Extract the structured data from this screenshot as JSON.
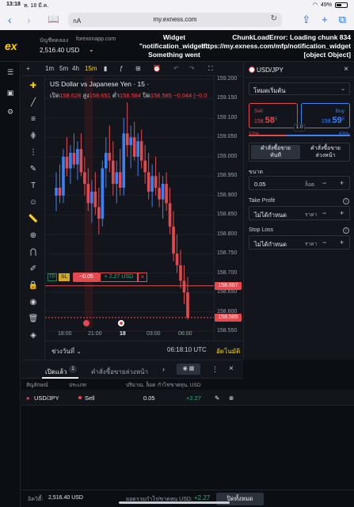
{
  "status_bar": {
    "time": "13:18",
    "date": "พ. 18 มี.ค.",
    "wifi": "wifi-icon",
    "battery_percent": "49%"
  },
  "browser": {
    "tab_label": "กA",
    "url": "my.exness.com",
    "back": "‹",
    "forward": "›"
  },
  "account": {
    "type": "บัญชีทดลอง",
    "server": "forexonapp.com",
    "balance": "2,516.40 USD"
  },
  "errors": {
    "widget": "Widget\n\"notification_widget\":\nSomething went\nwrong",
    "chunk": "ChunkLoadError: Loading chunk 834\nhttps://my.exness.com/mfp/notification_widget\n[object Object]"
  },
  "chart_toolbar": {
    "add": "+",
    "tf": [
      "1m",
      "5m",
      "4h",
      "15m"
    ],
    "active_tf": "15m"
  },
  "chart": {
    "title": "US Dollar vs Japanese Yen · 15 ·",
    "ohlc_open_label": "เปิด",
    "ohlc_open": "158.628",
    "ohlc_high_label": "สูง",
    "ohlc_high": "158.651",
    "ohlc_low_label": "ต่ำ",
    "ohlc_low": "158.584",
    "ohlc_close_label": "ปิด",
    "ohlc_close": "158.585",
    "ohlc_change": "−0.044 (−0.0",
    "price_ticks": [
      "159.200",
      "159.150",
      "159.100",
      "159.050",
      "159.000",
      "158.950",
      "158.900",
      "158.850",
      "158.800",
      "158.750",
      "158.700",
      "158.650",
      "158.600",
      "158.550"
    ],
    "position_price": "158.667",
    "current_price": "158.585",
    "time_ticks": [
      "18:00",
      "21:00",
      "18",
      "03:00",
      "06:00"
    ],
    "range_label": "ช่วงวันที่",
    "clock": "06:18:10 UTC",
    "auto_label": "อัตโนมัติ"
  },
  "chart_data": {
    "type": "candlestick",
    "title": "US Dollar vs Japanese Yen · 15",
    "ylim": [
      158.55,
      159.2
    ],
    "candles": [
      [
        158.9,
        158.96,
        158.86,
        158.92
      ],
      [
        158.92,
        158.98,
        158.88,
        158.9
      ],
      [
        158.9,
        159.02,
        158.88,
        159.0
      ],
      [
        159.0,
        159.05,
        158.95,
        158.97
      ],
      [
        158.97,
        159.03,
        158.93,
        159.01
      ],
      [
        159.01,
        159.06,
        158.97,
        158.98
      ],
      [
        158.98,
        159.04,
        158.94,
        159.02
      ],
      [
        159.02,
        159.06,
        158.95,
        158.96
      ],
      [
        158.96,
        159.0,
        158.9,
        158.93
      ],
      [
        158.93,
        158.97,
        158.86,
        158.88
      ],
      [
        158.88,
        158.94,
        158.83,
        158.91
      ],
      [
        158.91,
        158.96,
        158.85,
        158.87
      ],
      [
        158.87,
        158.92,
        158.8,
        158.84
      ],
      [
        158.84,
        158.99,
        158.82,
        158.97
      ],
      [
        158.97,
        159.05,
        158.92,
        159.01
      ],
      [
        159.01,
        159.08,
        158.96,
        158.99
      ],
      [
        158.99,
        159.04,
        158.9,
        158.93
      ],
      [
        158.93,
        158.99,
        158.88,
        158.96
      ],
      [
        158.96,
        159.02,
        158.9,
        158.92
      ],
      [
        158.92,
        159.1,
        158.9,
        159.06
      ],
      [
        159.06,
        159.14,
        159.0,
        159.03
      ],
      [
        159.03,
        159.08,
        158.97,
        159.05
      ],
      [
        159.05,
        159.09,
        158.99,
        159.0
      ],
      [
        159.0,
        159.06,
        158.95,
        159.04
      ],
      [
        159.04,
        159.07,
        158.97,
        158.99
      ],
      [
        158.99,
        159.03,
        158.93,
        158.96
      ],
      [
        158.96,
        159.01,
        158.89,
        158.91
      ],
      [
        158.91,
        158.98,
        158.87,
        158.95
      ],
      [
        158.95,
        159.0,
        158.9,
        158.92
      ],
      [
        158.92,
        158.96,
        158.87,
        158.89
      ],
      [
        158.89,
        158.95,
        158.84,
        158.93
      ],
      [
        158.93,
        158.96,
        158.86,
        158.88
      ],
      [
        158.88,
        158.92,
        158.8,
        158.82
      ],
      [
        158.82,
        158.86,
        158.73,
        158.75
      ],
      [
        158.75,
        158.8,
        158.7,
        158.72
      ],
      [
        158.72,
        158.76,
        158.66,
        158.68
      ],
      [
        158.68,
        158.72,
        158.62,
        158.65
      ],
      [
        158.65,
        158.69,
        158.58,
        158.585
      ]
    ]
  },
  "tools": [
    "crosshair-icon",
    "trendline-icon",
    "lines-icon",
    "channel-icon",
    "fib-icon",
    "brush-icon",
    "text-icon",
    "emoji-icon",
    "ruler-icon",
    "zoom-icon",
    "magnet-icon",
    "lock-draw-icon",
    "lock-icon",
    "eye-icon",
    "trash-icon",
    "layers-icon"
  ],
  "trade_line": {
    "tp": "TP",
    "sl": "SL",
    "loss": "−0.05",
    "pl": "+ 2.27 USD",
    "close": "×"
  },
  "order_panel": {
    "symbol": "USD/JPY",
    "mode": "โหมดเริ่มต้น",
    "sell_label": "Sell",
    "sell_price_prefix": "158.",
    "sell_price_big": "58",
    "sell_price_sup": "5",
    "buy_label": "Buy",
    "buy_price_prefix": "158.",
    "buy_price_big": "59",
    "buy_price_sup": "5",
    "spread": "1.0",
    "sell_pct": "37%",
    "buy_pct": "63%",
    "tab_market": "คำสั่งซื้อขาย\nทันที",
    "tab_pending": "คำสั่งซื้อขาย\nล่วงหน้า",
    "volume_label": "ขนาด",
    "volume_value": "0.05",
    "volume_unit": "ล็อต",
    "tp_label": "Take Profit",
    "tp_value": "ไม่ได้กำหนด",
    "tp_unit": "ราคา",
    "sl_label": "Stop Loss",
    "sl_value": "ไม่ได้กำหนด",
    "sl_unit": "ราคา",
    "minus": "−",
    "plus": "+"
  },
  "positions": {
    "tab_open": "เปิดแล้ว",
    "open_count": "1",
    "tab_pending": "คำสั่งซื้อขายล่วงหน้า",
    "columns": [
      "สัญลักษณ์",
      "ประเภท",
      "ปริมาณ, ล็อต",
      "กำไร/ขาดทุน, USD"
    ],
    "rows": [
      {
        "symbol": "USD/JPY",
        "type": "Sell",
        "volume": "0.05",
        "pl": "+2.27"
      }
    ]
  },
  "footer": {
    "equity_label": "อิควิตี้:",
    "equity": "2,516.40 USD",
    "pl_label": "ยอดรวมกำไร/ขาดทุน USD:",
    "pl": "+2.27",
    "close_all": "ปิดทั้งหมด"
  }
}
